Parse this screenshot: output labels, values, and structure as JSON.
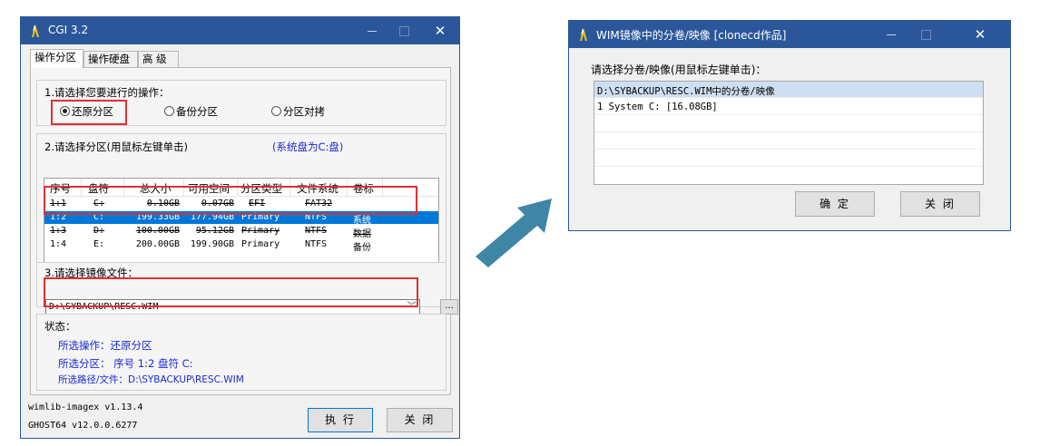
{
  "main_window": {
    "title": "CGI 3.2",
    "tabs": [
      "操作分区",
      "操作硬盘",
      "高 级"
    ],
    "step1": {
      "label": "1.请选择您要进行的操作：",
      "options": [
        "还原分区",
        "备份分区",
        "分区对拷"
      ],
      "selected": "还原分区"
    },
    "step2": {
      "label": "2.请选择分区(用鼠标左键单击)",
      "system_hint": "(系统盘为C:盘)",
      "columns": [
        "序号",
        "盘符",
        "总大小",
        "可用空间",
        "分区类型",
        "文件系统",
        "卷标"
      ],
      "rows": [
        {
          "no": "1:1",
          "drive": "C:",
          "total": "0.10GB",
          "free": "0.07GB",
          "type": "EFI",
          "fs": "FAT32",
          "label": ""
        },
        {
          "no": "1:2",
          "drive": "C:",
          "total": "199.33GB",
          "free": "177.94GB",
          "type": "Primary",
          "fs": "NTFS",
          "label": "系统"
        },
        {
          "no": "1:3",
          "drive": "D:",
          "total": "100.00GB",
          "free": "95.12GB",
          "type": "Primary",
          "fs": "NTFS",
          "label": "数据"
        },
        {
          "no": "1:4",
          "drive": "E:",
          "total": "200.00GB",
          "free": "199.90GB",
          "type": "Primary",
          "fs": "NTFS",
          "label": "备份"
        }
      ],
      "selected_row": 1
    },
    "step3": {
      "label": "3.请选择镜像文件：",
      "file_value": "D:\\SYBACKUP\\RESC.WIM",
      "browse_label": "..."
    },
    "status": {
      "heading": "状态：",
      "operation": "所选操作：还原分区",
      "partition": "所选分区：  序号 1:2      盘符 C:",
      "path": "所选路径/文件：D:\\SYBACKUP\\RESC.WIM"
    },
    "footer": {
      "version_line1": "wimlib-imagex v1.13.4",
      "version_line2": "GHOST64 v12.0.0.6277",
      "execute_label": "执 行",
      "close_label": "关 闭"
    }
  },
  "dialog": {
    "title": "WIM镜像中的分卷/映像    [clonecd作品]",
    "prompt": "请选择分卷/映像(用鼠标左键单击)：",
    "list_header": "D:\\SYBACKUP\\RESC.WIM中的分卷/映像",
    "items": [
      "1  System C: [16.08GB]"
    ],
    "ok_label": "确 定",
    "close_label": "关 闭"
  },
  "colors": {
    "titlebar": "#2b579a",
    "selection": "#0078d7",
    "highlight_box": "#e03030",
    "arrow": "#3f86a6",
    "status_text": "#1a2ad4"
  }
}
